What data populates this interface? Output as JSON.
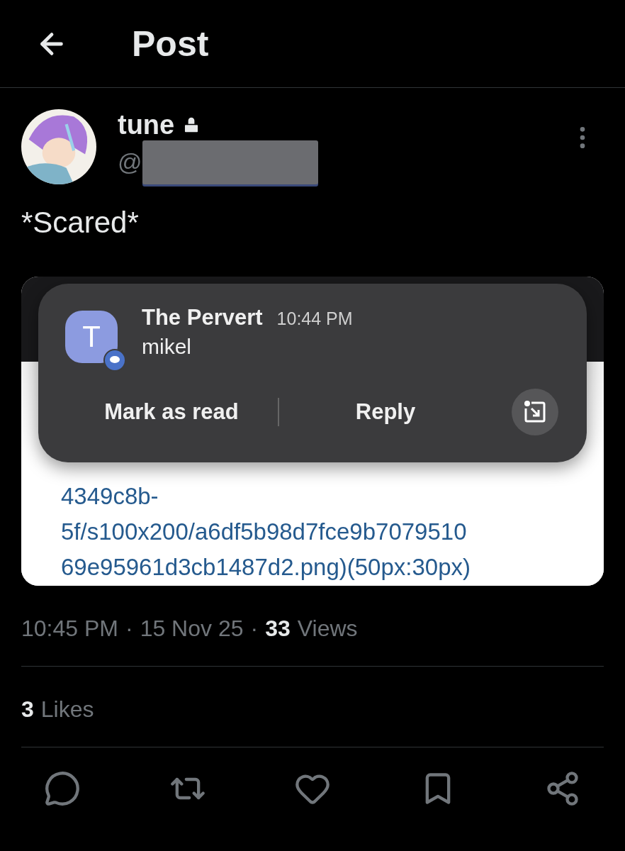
{
  "header": {
    "title": "Post"
  },
  "post": {
    "author": {
      "name": "tune",
      "locked": true,
      "handle_prefix": "@"
    },
    "text": "*Scared*",
    "screenshot": {
      "notification": {
        "avatar_letter": "T",
        "sender": "The Pervert",
        "time": "10:44 PM",
        "message": "mikel",
        "actions": [
          "Mark as read",
          "Reply"
        ]
      },
      "link_lines": [
        "4349c8b-",
        "5f/s100x200/a6df5b98d7fce9b7079510",
        "69e95961d3cb1487d2.png)(50px:30px)"
      ]
    }
  },
  "meta": {
    "time": "10:45 PM",
    "separators": [
      "·",
      "·"
    ],
    "date": "15 Nov 25",
    "views_count": "33",
    "views_label": "Views"
  },
  "likes": {
    "count": "3",
    "label": "Likes"
  },
  "actions": [
    {
      "kind": "reply"
    },
    {
      "kind": "repost"
    },
    {
      "kind": "like"
    },
    {
      "kind": "bookmark"
    },
    {
      "kind": "share"
    }
  ]
}
